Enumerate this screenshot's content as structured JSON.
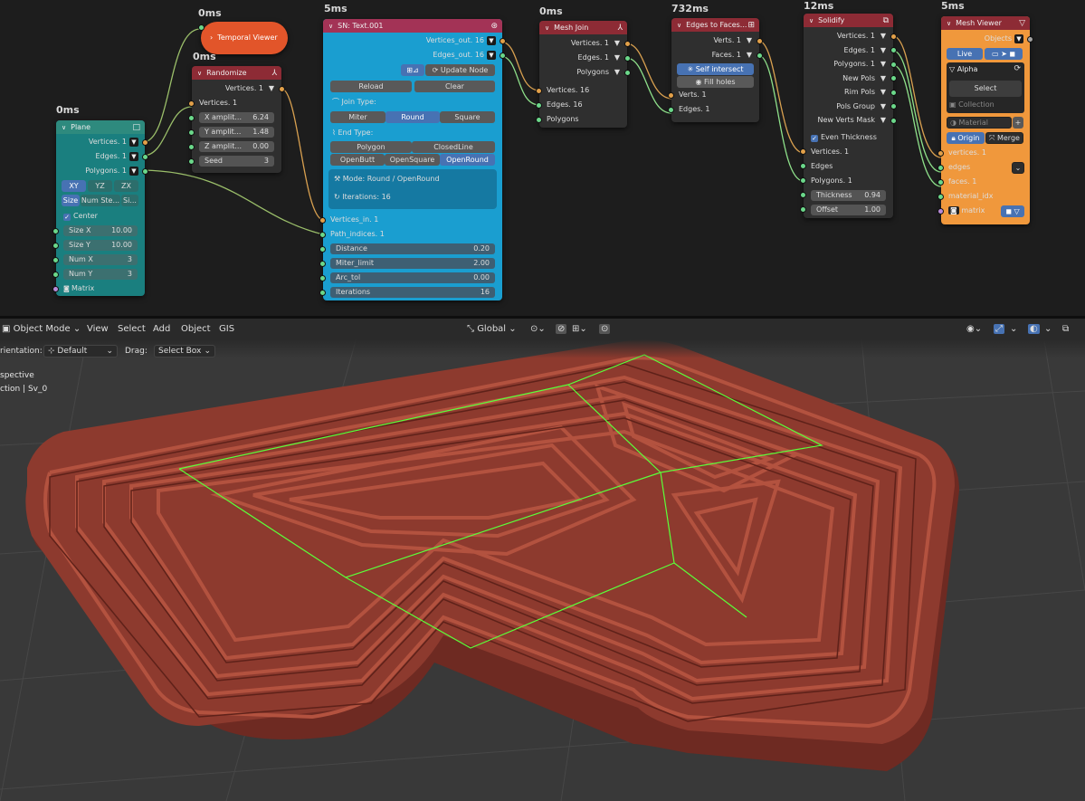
{
  "timings": {
    "temporal": "0ms",
    "randomize": "0ms",
    "plane": "0ms",
    "text": "5ms",
    "mesh_join": "0ms",
    "edges_to_faces": "732ms",
    "solidify": "12ms",
    "mesh_viewer": "5ms"
  },
  "nodes": {
    "temporal_viewer": {
      "title": "Temporal Viewer"
    },
    "randomize": {
      "title": "Randomize",
      "out": "Vertices. 1",
      "in": "Vertices. 1",
      "fields": [
        [
          "X amplit...",
          "6.24"
        ],
        [
          "Y amplit...",
          "1.48"
        ],
        [
          "Z amplit...",
          "0.00"
        ],
        [
          "Seed",
          "3"
        ]
      ]
    },
    "plane": {
      "title": "Plane",
      "outs": [
        "Vertices. 1",
        "Edges. 1",
        "Polygons. 1"
      ],
      "axes": [
        "XY",
        "YZ",
        "ZX"
      ],
      "modes": [
        "Size",
        "Num Ste...",
        "Si..."
      ],
      "center": "Center",
      "fields": [
        [
          "Size X",
          "10.00"
        ],
        [
          "Size Y",
          "10.00"
        ],
        [
          "Num X",
          "3"
        ],
        [
          "Num Y",
          "3"
        ]
      ],
      "matrix": "Matrix"
    },
    "text": {
      "title": "SN: Text.001",
      "outs": [
        "Vertices_out. 16",
        "Edges_out. 16"
      ],
      "update": "Update Node",
      "reload": "Reload",
      "clear": "Clear",
      "join_label": "Join Type:",
      "join": [
        "Miter",
        "Round",
        "Square"
      ],
      "end_label": "End Type:",
      "end1": [
        "Polygon",
        "ClosedLine"
      ],
      "end2": [
        "OpenButt",
        "OpenSquare",
        "OpenRound"
      ],
      "mode": "Mode: Round / OpenRound",
      "iterations": "Iterations: 16",
      "ins": [
        "Vertices_in. 1",
        "Path_indices. 1"
      ],
      "fields": [
        [
          "Distance",
          "0.20"
        ],
        [
          "Miter_limit",
          "2.00"
        ],
        [
          "Arc_tol",
          "0.00"
        ],
        [
          "Iterations",
          "16"
        ]
      ]
    },
    "mesh_join": {
      "title": "Mesh Join",
      "outs": [
        "Vertices. 1",
        "Edges. 1",
        "Polygons"
      ],
      "ins": [
        "Vertices. 16",
        "Edges. 16",
        "Polygons"
      ]
    },
    "edges_to_faces": {
      "title": "Edges to Faces...",
      "outs": [
        "Verts. 1",
        "Faces. 1"
      ],
      "self_intersect": "Self intersect",
      "fill_holes": "Fill holes",
      "ins": [
        "Verts. 1",
        "Edges. 1"
      ]
    },
    "solidify": {
      "title": "Solidify",
      "outs": [
        "Vertices. 1",
        "Edges. 1",
        "Polygons. 1",
        "New Pols",
        "Rim Pols",
        "Pols Group",
        "New Verts Mask"
      ],
      "even": "Even Thickness",
      "ins": [
        "Vertices. 1",
        "Edges",
        "Polygons. 1"
      ],
      "fields": [
        [
          "Thickness",
          "0.94"
        ],
        [
          "Offset",
          "1.00"
        ]
      ]
    },
    "mesh_viewer": {
      "title": "Mesh Viewer",
      "objects": "Objects",
      "live": "Live",
      "alpha": "Alpha",
      "select": "Select",
      "collection": "Collection",
      "material": "Material",
      "origin": "Origin",
      "merge": "Merge",
      "ins": [
        "vertices. 1",
        "edges",
        "faces. 1",
        "material_idx",
        "matrix"
      ]
    }
  },
  "viewport": {
    "menu": [
      "Object Mode",
      "View",
      "Select",
      "Add",
      "Object",
      "GIS"
    ],
    "orientation_label": "rientation:",
    "orientation": "Default",
    "drag_label": "Drag:",
    "drag": "Select Box",
    "transform": "Global",
    "overlay_line1": "spective",
    "overlay_line2": "ction | Sv_0",
    "colors": {
      "mesh": "#9b4436",
      "wire": "#5bff3a"
    }
  }
}
